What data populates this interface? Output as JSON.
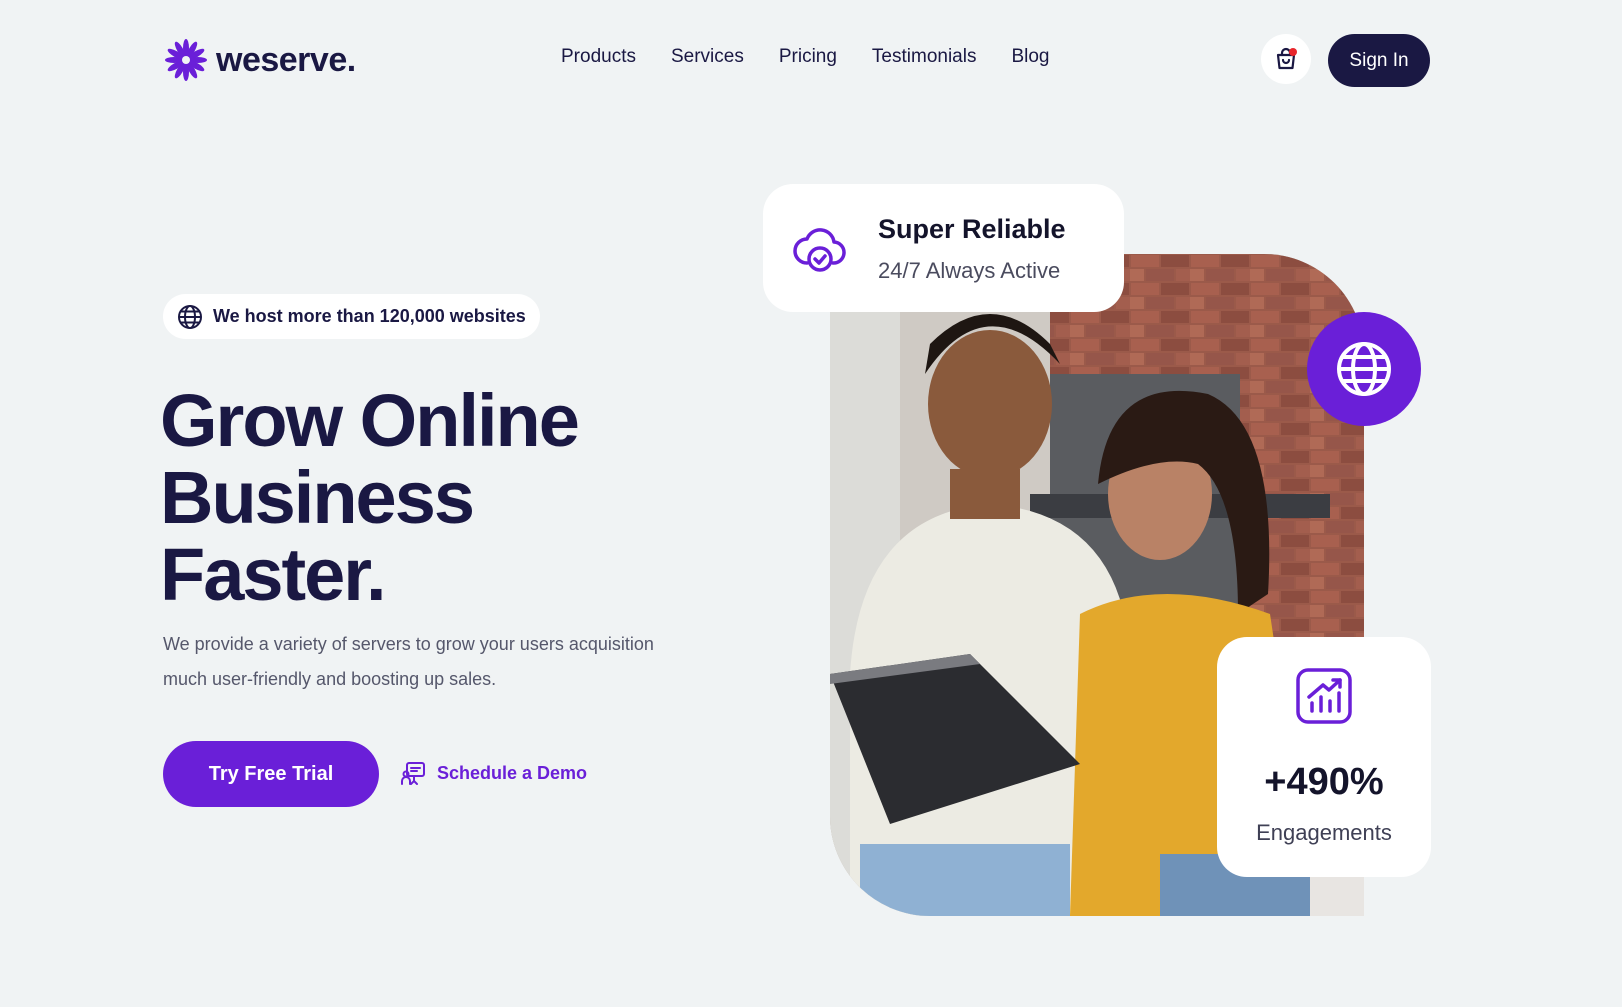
{
  "brand": {
    "name": "weserve.",
    "accent": "#6a1fd8",
    "dark": "#1a1843"
  },
  "nav": {
    "items": [
      "Products",
      "Services",
      "Pricing",
      "Testimonials",
      "Blog"
    ]
  },
  "header": {
    "cart_icon": "shopping-bag-icon",
    "signin_label": "Sign In"
  },
  "hero": {
    "badge_icon": "globe-icon",
    "badge_text": "We host more than 120,000 websites",
    "headline": [
      "Grow Online",
      "Business",
      "Faster."
    ],
    "subtext": "We provide a variety of servers to grow your users acquisition much user-friendly and boosting up sales.",
    "primary_cta": "Try Free Trial",
    "secondary_cta": "Schedule a Demo",
    "secondary_cta_icon": "presentation-icon"
  },
  "cards": {
    "reliable": {
      "icon": "cloud-check-icon",
      "title": "Super Reliable",
      "subtitle": "24/7 Always Active"
    },
    "globe": {
      "icon": "globe-icon"
    },
    "engagement": {
      "icon": "chart-growth-icon",
      "value": "+490%",
      "label": "Engagements"
    }
  }
}
